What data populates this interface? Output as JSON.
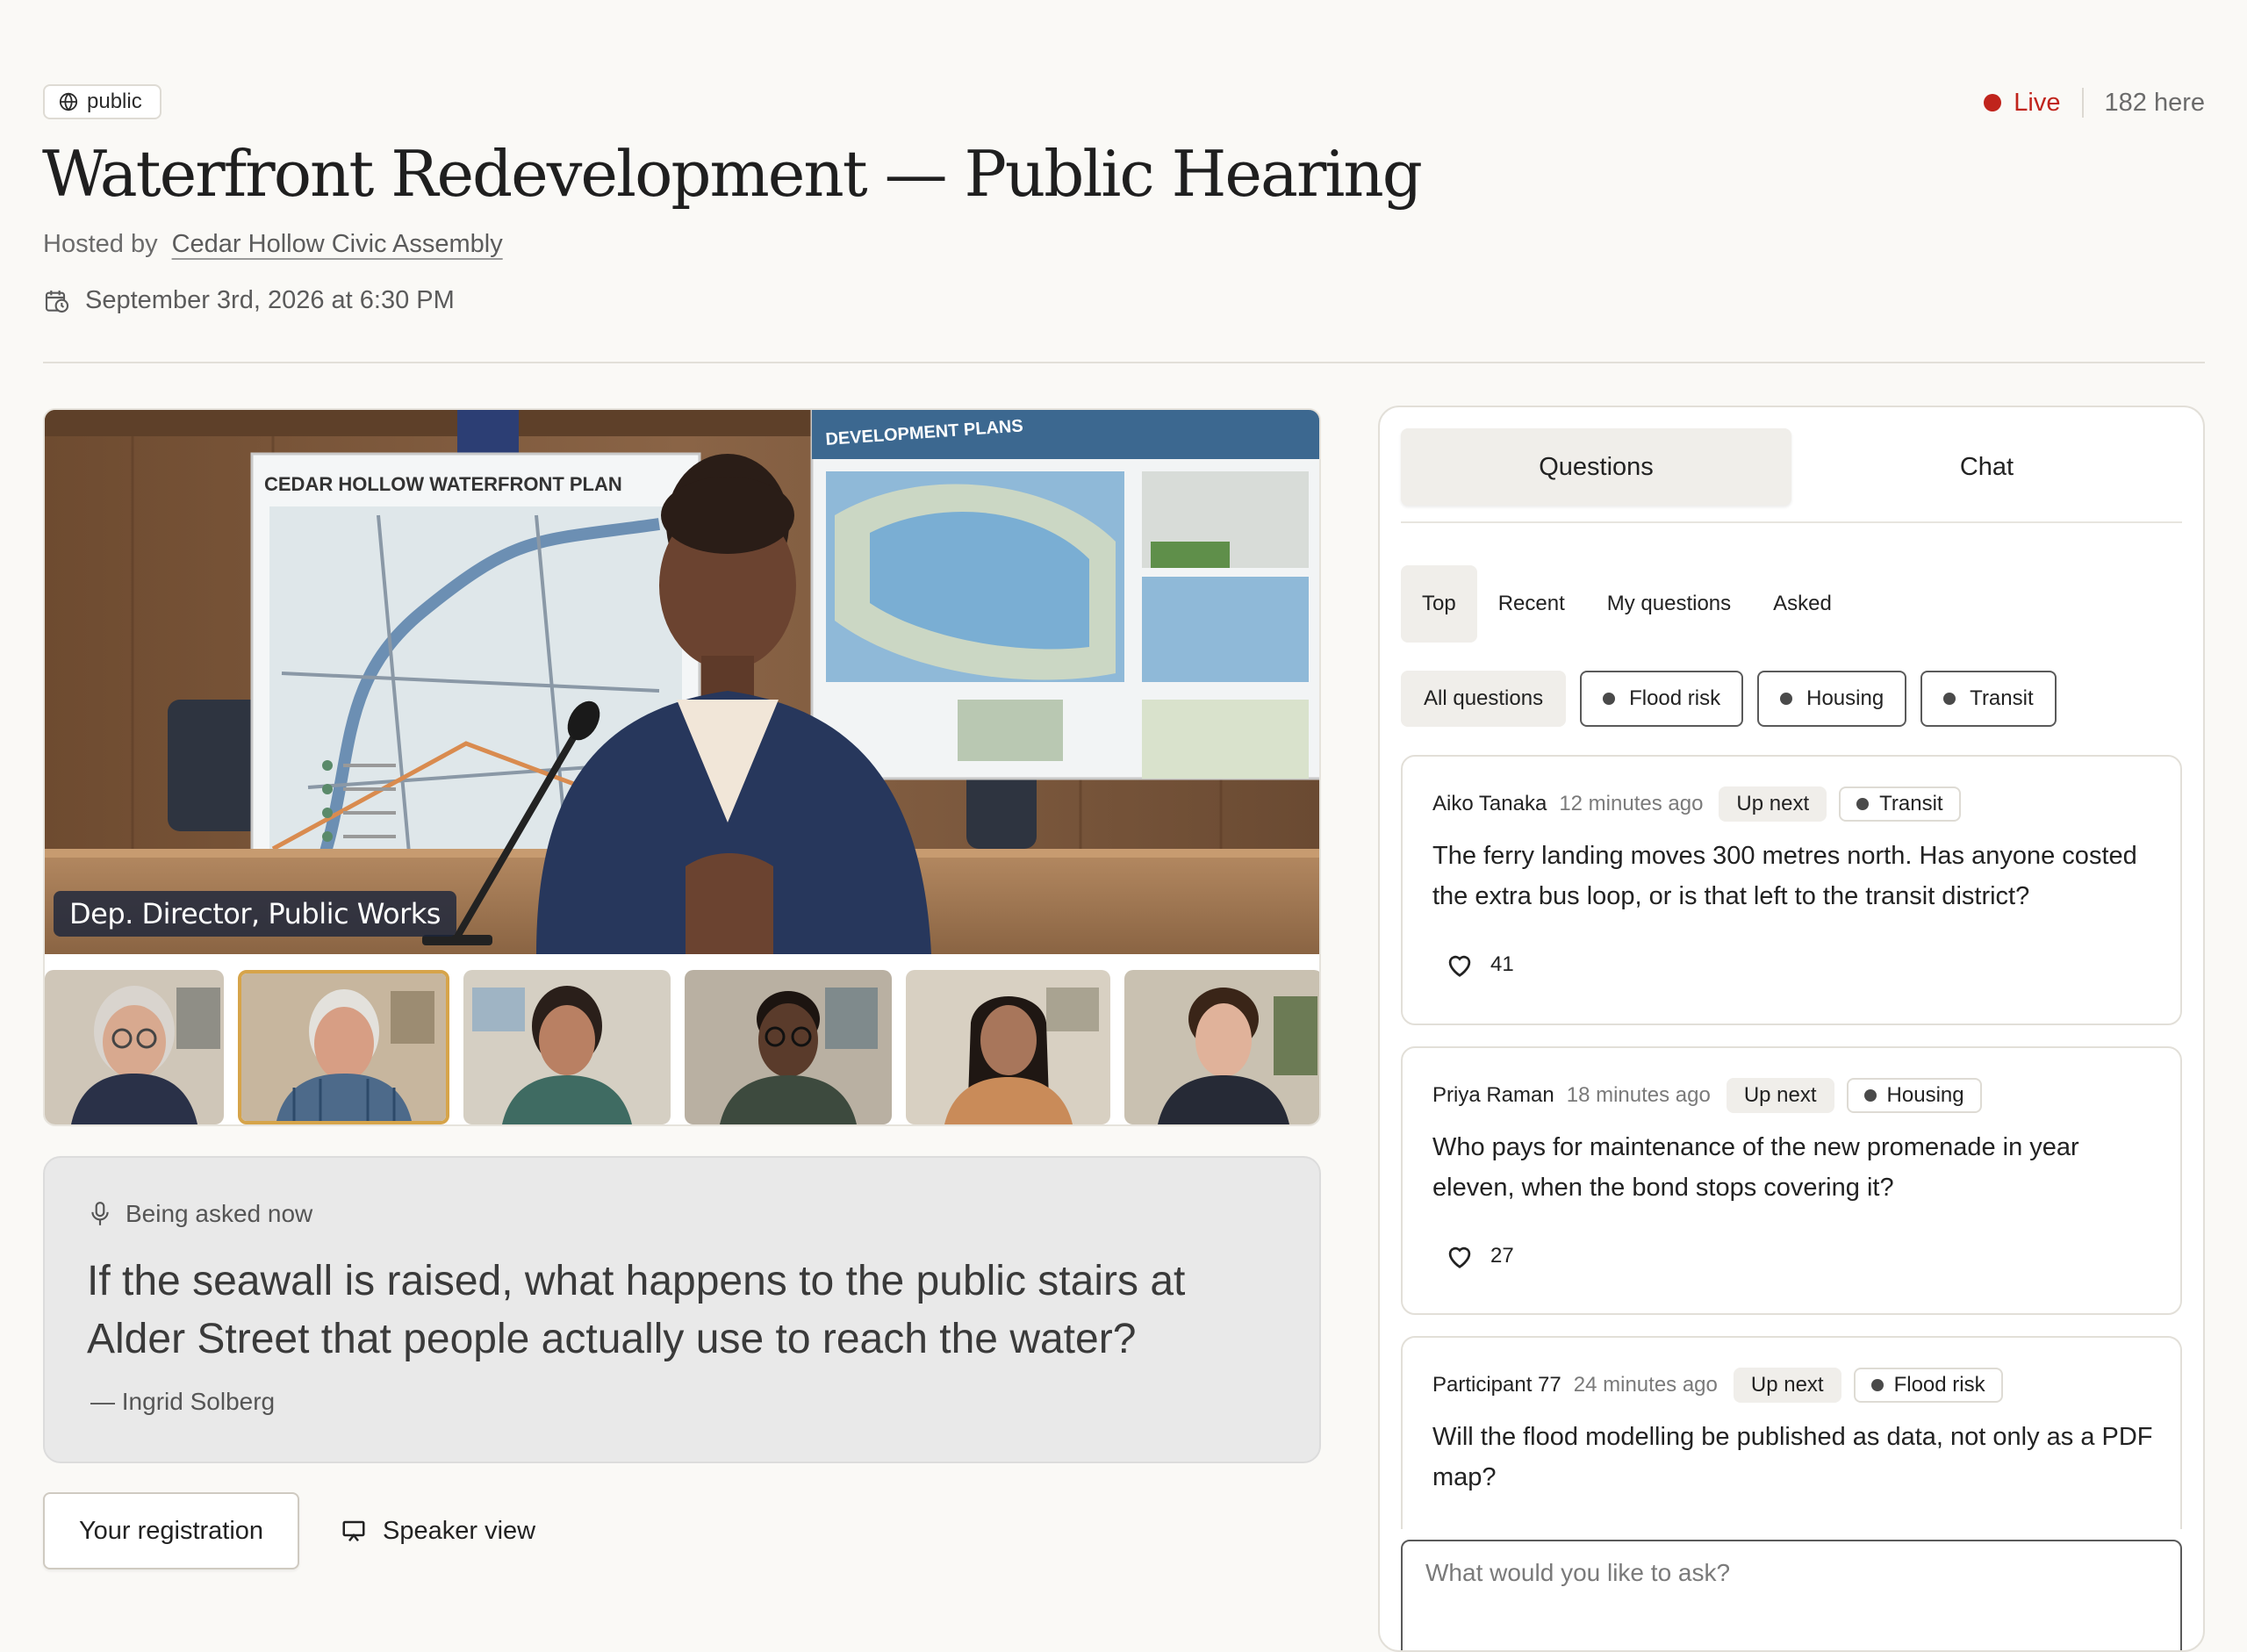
{
  "header": {
    "visibility": "public",
    "title": "Waterfront Redevelopment — Public Hearing",
    "hosted_prefix": "Hosted by",
    "host": "Cedar Hollow Civic Assembly",
    "datetime": "September 3rd, 2026 at 6:30 PM",
    "live_label": "Live",
    "attendance": "182 here"
  },
  "video": {
    "caption": "Dep. Director, Public Works",
    "board_left_title": "CEDAR HOLLOW WATERFRONT PLAN",
    "board_right_title": "DEVELOPMENT PLANS"
  },
  "being_asked": {
    "label": "Being asked now",
    "question": "If the seawall is raised, what happens to the public stairs at Alder Street that people actually use to reach the water?",
    "author": "— Ingrid Solberg"
  },
  "actions": {
    "registration": "Your registration",
    "speaker_view": "Speaker view"
  },
  "panel": {
    "tabs": [
      "Questions",
      "Chat"
    ],
    "sorts": [
      "Top",
      "Recent",
      "My questions",
      "Asked"
    ],
    "filters": [
      "All questions",
      "Flood risk",
      "Housing",
      "Transit"
    ],
    "up_next_label": "Up next",
    "questions": [
      {
        "author": "Aiko Tanaka",
        "time": "12 minutes ago",
        "tag": "Transit",
        "text": "The ferry landing moves 300 metres north. Has anyone costed the extra bus loop, or is that left to the transit district?",
        "likes": "41"
      },
      {
        "author": "Priya Raman",
        "time": "18 minutes ago",
        "tag": "Housing",
        "text": "Who pays for maintenance of the new promenade in year eleven, when the bond stops covering it?",
        "likes": "27"
      },
      {
        "author": "Participant 77",
        "time": "24 minutes ago",
        "tag": "Flood risk",
        "text": "Will the flood modelling be published as data, not only as a PDF map?"
      }
    ],
    "ask_placeholder": "What would you like to ask?"
  },
  "colors": {
    "live": "#c0241c",
    "active_thumb_border": "#d6a44a"
  }
}
